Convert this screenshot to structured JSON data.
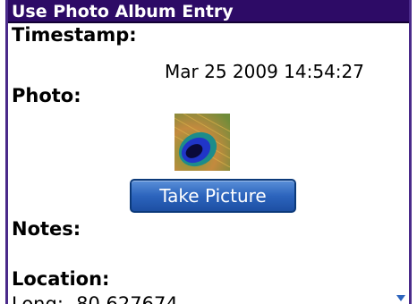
{
  "window": {
    "title": "Use Photo Album Entry"
  },
  "fields": {
    "timestamp_label": "Timestamp:",
    "timestamp_value": "Mar 25 2009 14:54:27",
    "photo_label": "Photo:",
    "notes_label": "Notes:",
    "location_label": "Location:",
    "longitude_text": "Long: -80.627674"
  },
  "actions": {
    "take_picture_label": "Take Picture"
  },
  "icons": {
    "photo": "peacock-feather-photo",
    "scroll": "scroll-down-arrow-icon"
  },
  "colors": {
    "titlebar_bg": "#2d0b66",
    "button_bg": "#2c64bd"
  }
}
